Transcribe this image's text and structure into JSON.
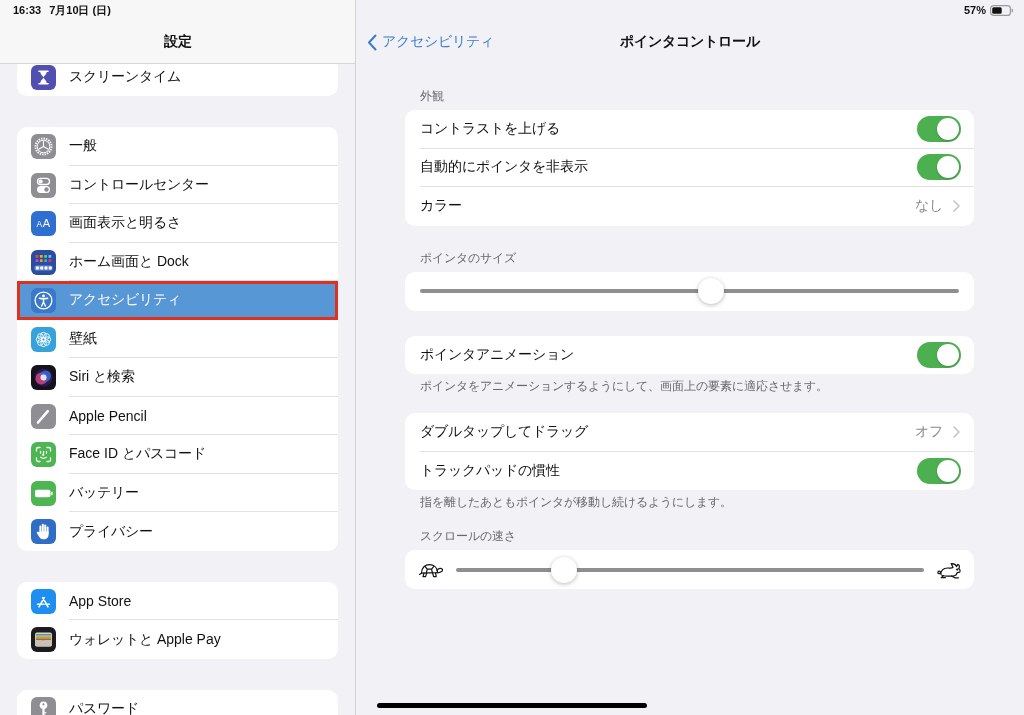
{
  "status_bar": {
    "time": "16:33",
    "date": "7月10日 (日)",
    "battery": "57%"
  },
  "sidebar": {
    "title": "設定",
    "groups": [
      {
        "items": [
          {
            "kind": "hourglass",
            "label": "スクリーンタイム",
            "selected": false,
            "outlined": false
          }
        ]
      },
      {
        "items": [
          {
            "kind": "gear",
            "label": "一般",
            "selected": false,
            "outlined": false
          },
          {
            "kind": "switches",
            "label": "コントロールセンター",
            "selected": false,
            "outlined": false
          },
          {
            "kind": "letters",
            "icon_text": "AA",
            "label": "画面表示と明るさ",
            "selected": false,
            "outlined": false
          },
          {
            "kind": "grid",
            "label": "ホーム画面と Dock",
            "selected": false,
            "outlined": false
          },
          {
            "kind": "accessibility",
            "label": "アクセシビリティ",
            "selected": true,
            "outlined": true
          },
          {
            "kind": "flower",
            "label": "壁紙",
            "selected": false,
            "outlined": false
          },
          {
            "kind": "orb",
            "label": "Siri と検索",
            "selected": false,
            "outlined": false
          },
          {
            "kind": "pencil",
            "label": "Apple Pencil",
            "selected": false,
            "outlined": false
          },
          {
            "kind": "face",
            "label": "Face ID とパスコード",
            "selected": false,
            "outlined": false
          },
          {
            "kind": "battery",
            "label": "バッテリー",
            "selected": false,
            "outlined": false
          },
          {
            "kind": "hand",
            "label": "プライバシー",
            "selected": false,
            "outlined": false
          }
        ]
      },
      {
        "items": [
          {
            "kind": "store",
            "label": "App Store",
            "selected": false,
            "outlined": false
          },
          {
            "kind": "wallet",
            "label": "ウォレットと Apple Pay",
            "selected": false,
            "outlined": false
          }
        ]
      },
      {
        "items": [
          {
            "kind": "key",
            "label": "パスワード",
            "selected": false,
            "outlined": false
          }
        ]
      }
    ]
  },
  "detail": {
    "back": "アクセシビリティ",
    "title": "ポインタコントロール",
    "sections": [
      {
        "header": "外観",
        "rows": [
          {
            "kind": "toggle",
            "label": "コントラストを上げる",
            "on": true
          },
          {
            "kind": "toggle",
            "label": "自動的にポインタを非表示",
            "on": true
          },
          {
            "kind": "link",
            "label": "カラー",
            "value": "なし"
          }
        ]
      },
      {
        "header": "ポインタのサイズ",
        "rows": [
          {
            "kind": "slider",
            "level": 0.54
          }
        ]
      },
      {
        "rows": [
          {
            "kind": "toggle",
            "label": "ポインタアニメーション",
            "on": true
          }
        ],
        "footer": "ポインタをアニメーションするようにして、画面上の要素に適応させます。"
      },
      {
        "rows": [
          {
            "kind": "link",
            "label": "ダブルタップしてドラッグ",
            "value": "オフ"
          },
          {
            "kind": "toggle",
            "label": "トラックパッドの慣性",
            "on": true
          }
        ],
        "footer": "指を離したあともポインタが移動し続けるようにします。"
      },
      {
        "header": "スクロールの速さ",
        "rows": [
          {
            "kind": "speed",
            "level": 0.23
          }
        ]
      }
    ]
  }
}
